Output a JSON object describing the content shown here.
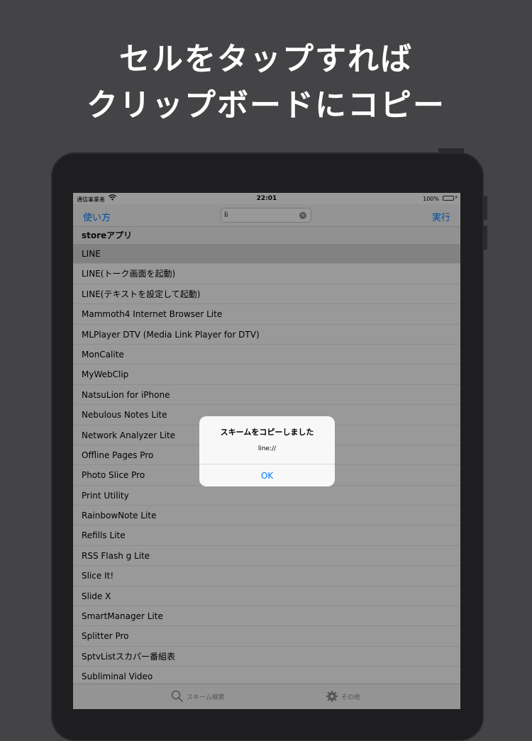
{
  "headline": {
    "line1": "セルをタップすれば",
    "line2": "クリップボードにコピー"
  },
  "status_bar": {
    "carrier": "通信事業者",
    "wifi_icon": "wifi-icon",
    "time": "22:01",
    "battery": "100%",
    "battery_level": 1.0
  },
  "nav_bar": {
    "left_button": "使い方",
    "search_value": "li",
    "right_button": "実行"
  },
  "section_header": "storeアプリ",
  "list": {
    "selected_index": 0,
    "items": [
      "LINE",
      "LINE(トーク画面を起動)",
      "LINE(テキストを設定して起動)",
      "Mammoth4 Internet Browser Lite",
      "MLPlayer DTV (Media Link Player for DTV)",
      "MonCalite",
      "MyWebClip",
      "NatsuLion for iPhone",
      "Nebulous Notes Lite",
      "Network Analyzer Lite",
      "Offline Pages Pro",
      "Photo Slice Pro",
      "Print Utility",
      "RainbowNote Lite",
      "Refills Lite",
      "RSS Flash g Lite",
      "Slice It!",
      "Slide X",
      "SmartManager Lite",
      "Splitter Pro",
      "SptvListスカパー番組表",
      "Subliminal Video"
    ]
  },
  "tab_bar": {
    "search_label": "スキーム検索",
    "other_label": "その他"
  },
  "alert": {
    "title": "スキームをコピーしました",
    "message": "line://",
    "ok": "OK"
  },
  "colors": {
    "background": "#444446",
    "accent": "#007aff",
    "battery": "#4cd964"
  }
}
